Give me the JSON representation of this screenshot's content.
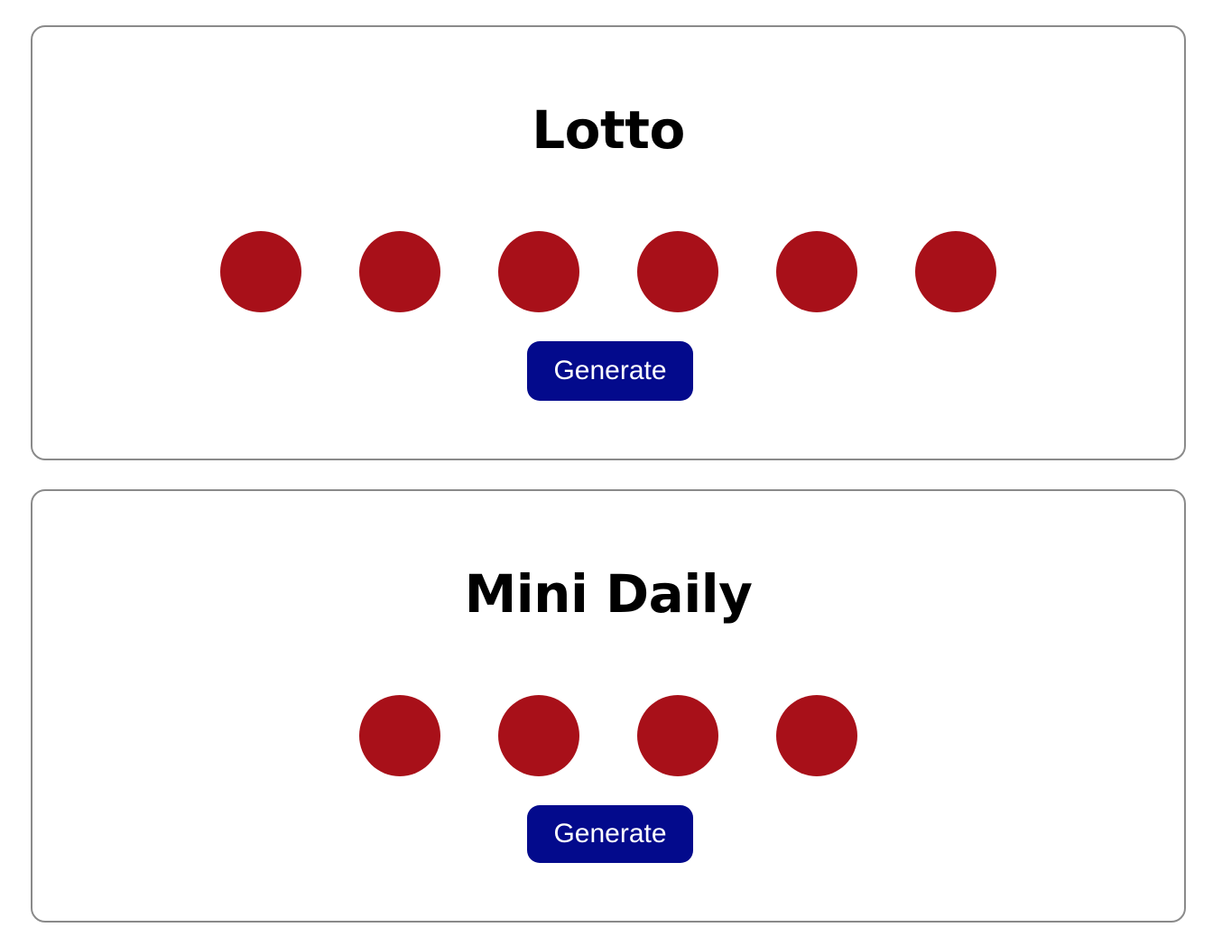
{
  "colors": {
    "ball": "#a81019",
    "button": "#030a8c",
    "border": "#8a8a8a"
  },
  "lotto": {
    "title": "Lotto",
    "balls": [
      "",
      "",
      "",
      "",
      "",
      ""
    ],
    "button_label": "Generate"
  },
  "mini_daily": {
    "title": "Mini Daily",
    "balls": [
      "",
      "",
      "",
      ""
    ],
    "button_label": "Generate"
  }
}
